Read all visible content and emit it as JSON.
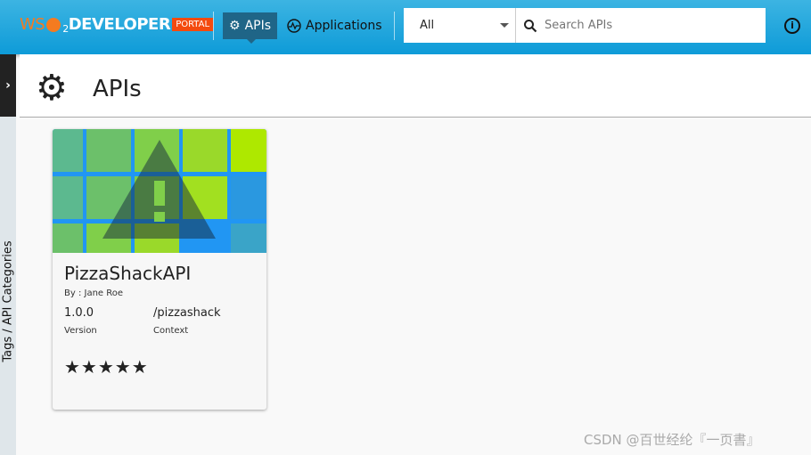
{
  "header": {
    "logo": {
      "ws": "WS",
      "two": "2",
      "developer": "DEVELOPER",
      "portal": "PORTAL"
    },
    "nav": [
      {
        "label": "APIs",
        "icon": "gear-icon",
        "active": true
      },
      {
        "label": "Applications",
        "icon": "activity-icon",
        "active": false
      }
    ],
    "filter": {
      "selected": "All"
    },
    "search": {
      "placeholder": "Search APIs",
      "value": ""
    },
    "info_icon": "i"
  },
  "sidebar": {
    "toggle": "›",
    "label": "Tags / API Categories"
  },
  "page": {
    "title": "APIs"
  },
  "apis": [
    {
      "name": "PizzaShackAPI",
      "by": "By : Jane Roe",
      "version": "1.0.0",
      "version_label": "Version",
      "context": "/pizzashack",
      "context_label": "Context",
      "rating": 5,
      "stars": "★★★★★"
    }
  ],
  "watermark": "CSDN @百世经纶『一页書』",
  "colors": {
    "header": "#0e9bd8",
    "active_nav": "#1f6587",
    "portal_badge": "#f44a0e"
  }
}
